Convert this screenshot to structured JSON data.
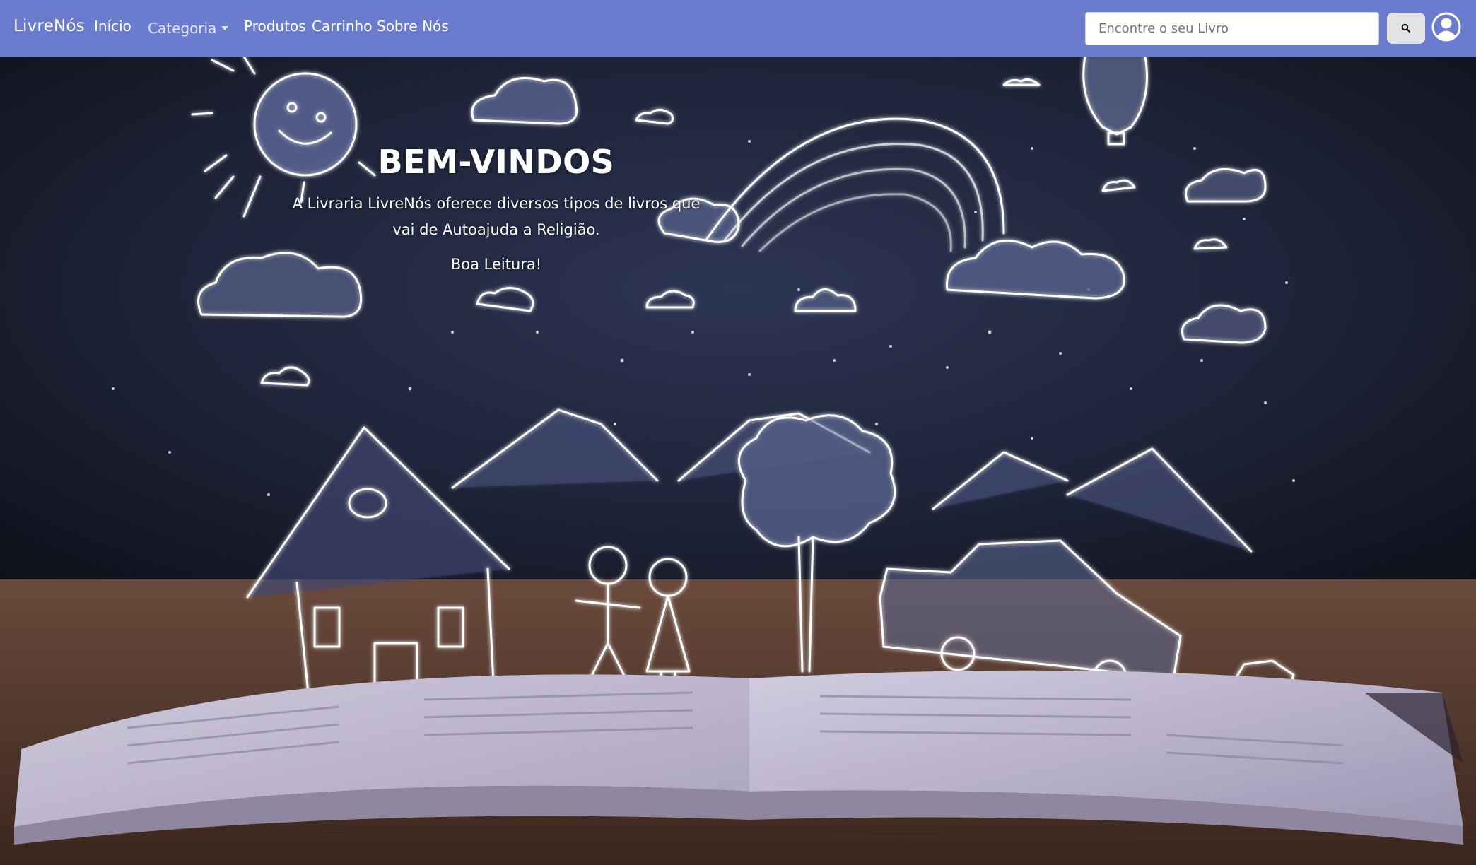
{
  "navbar": {
    "brand": "LivreNós",
    "links": {
      "home": "Início",
      "category": "Categoria",
      "products": "Produtos",
      "cart": "Carrinho",
      "about": "Sobre Nós"
    },
    "search": {
      "placeholder": "Encontre o seu Livro",
      "value": "",
      "button_icon": "search-icon"
    },
    "user_icon": "user-circle-icon",
    "background_color": "#6b7bce"
  },
  "hero": {
    "title": "BEM-VINDOS",
    "description": "A Livraria LivreNós oferece diversos tipos de livros que vai de Autoajuda a Religião.",
    "greeting": "Boa Leitura!",
    "background_image": "open book with glowing chalk doodles (sun, clouds, rainbow, balloon, house, kids, tree, car, dog, mountains) on dark blue background over wooden table"
  }
}
